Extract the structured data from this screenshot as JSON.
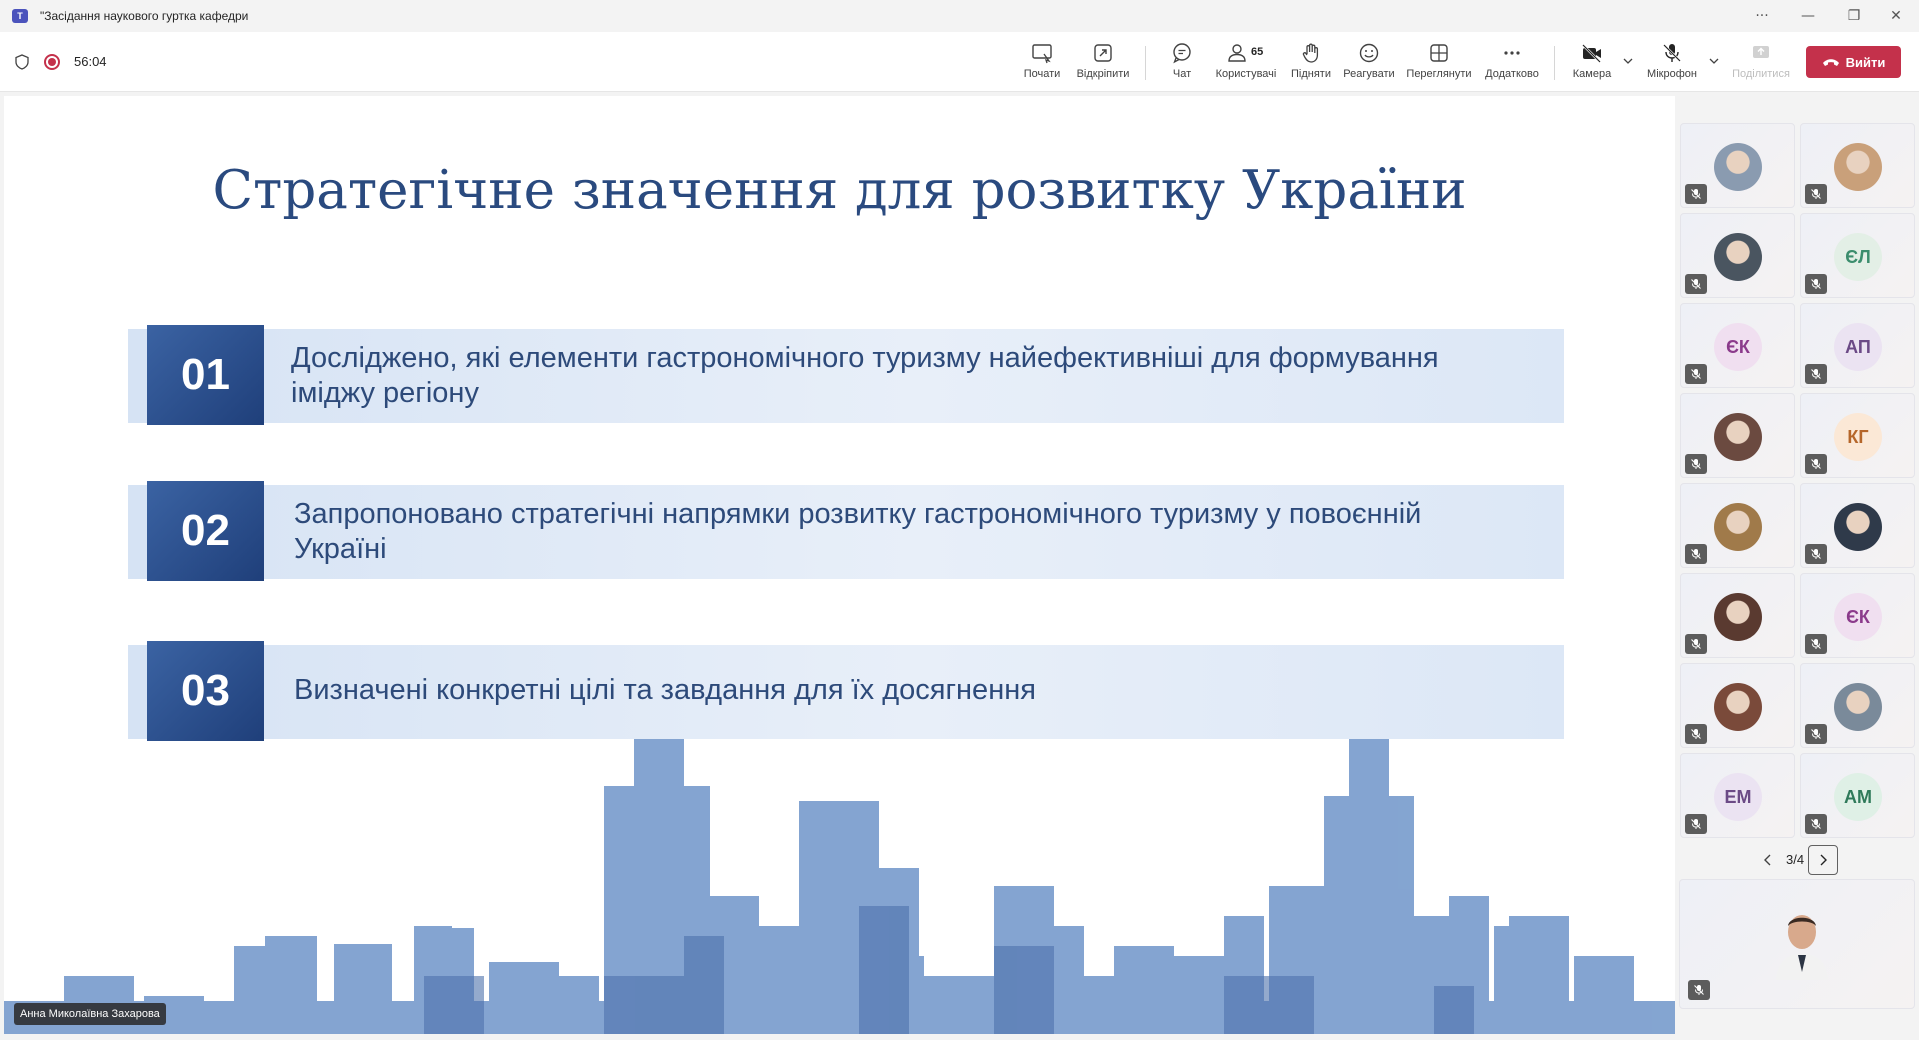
{
  "window": {
    "title": "\"Засідання наукового гуртка кафедри"
  },
  "toolbar": {
    "timer": "56:04",
    "participants_count": "65",
    "buttons": [
      {
        "key": "start",
        "label": "Почати",
        "icon": "screen-start-icon"
      },
      {
        "key": "popout",
        "label": "Відкріпити",
        "icon": "popout-icon"
      },
      {
        "key": "chat",
        "label": "Чат",
        "icon": "chat-icon"
      },
      {
        "key": "people",
        "label": "Користувачі",
        "icon": "people-icon"
      },
      {
        "key": "raise",
        "label": "Підняти",
        "icon": "raise-hand-icon"
      },
      {
        "key": "react",
        "label": "Реагувати",
        "icon": "smile-icon"
      },
      {
        "key": "view",
        "label": "Переглянути",
        "icon": "grid-view-icon"
      },
      {
        "key": "more",
        "label": "Додатково",
        "icon": "more-icon"
      },
      {
        "key": "camera",
        "label": "Камера",
        "icon": "camera-off-icon"
      },
      {
        "key": "mic",
        "label": "Мікрофон",
        "icon": "mic-off-icon"
      },
      {
        "key": "share",
        "label": "Поділитися",
        "icon": "share-icon"
      }
    ],
    "leave_label": "Вийти"
  },
  "slide": {
    "title": "Стратегічне значення для розвитку України",
    "items": [
      {
        "num": "01",
        "text": "Досліджено, які елементи гастрономічного туризму найефективніші для формування іміджу регіону"
      },
      {
        "num": "02",
        "text": "Запропоновано стратегічні напрямки розвитку гастрономічного туризму у повоєнній Україні"
      },
      {
        "num": "03",
        "text": "Визначені конкретні цілі та завдання для їх досягнення"
      }
    ],
    "presenter_name": "Анна Миколаївна Захарова"
  },
  "participants": [
    {
      "initials": "",
      "type": "photo",
      "color": "#8a9bb0"
    },
    {
      "initials": "",
      "type": "photo",
      "color": "#c9a07a"
    },
    {
      "initials": "",
      "type": "photo",
      "color": "#4a5560"
    },
    {
      "initials": "ЄЛ",
      "type": "initials",
      "color": "#3b8d6d",
      "bg": "#e3efe6"
    },
    {
      "initials": "ЄК",
      "type": "initials",
      "color": "#8b3a8b",
      "bg": "#f0dff0"
    },
    {
      "initials": "АП",
      "type": "initials",
      "color": "#6b4a86",
      "bg": "#ebe3f2"
    },
    {
      "initials": "",
      "type": "photo",
      "color": "#6b4a40"
    },
    {
      "initials": "КГ",
      "type": "initials",
      "color": "#b5662a",
      "bg": "#fbe8d6"
    },
    {
      "initials": "",
      "type": "photo",
      "color": "#a07a4a"
    },
    {
      "initials": "",
      "type": "photo",
      "color": "#2f3a4a"
    },
    {
      "initials": "",
      "type": "photo",
      "color": "#5a3a30"
    },
    {
      "initials": "ЄК",
      "type": "initials",
      "color": "#8b3a8b",
      "bg": "#f0dff0"
    },
    {
      "initials": "",
      "type": "photo",
      "color": "#7a4a3a"
    },
    {
      "initials": "",
      "type": "photo",
      "color": "#7a8a9a"
    },
    {
      "initials": "ЕМ",
      "type": "initials",
      "color": "#6b4a86",
      "bg": "#ebe3f2"
    },
    {
      "initials": "АМ",
      "type": "initials",
      "color": "#2f7a5a",
      "bg": "#dff0e6"
    }
  ],
  "pager": {
    "text": "3/4"
  }
}
